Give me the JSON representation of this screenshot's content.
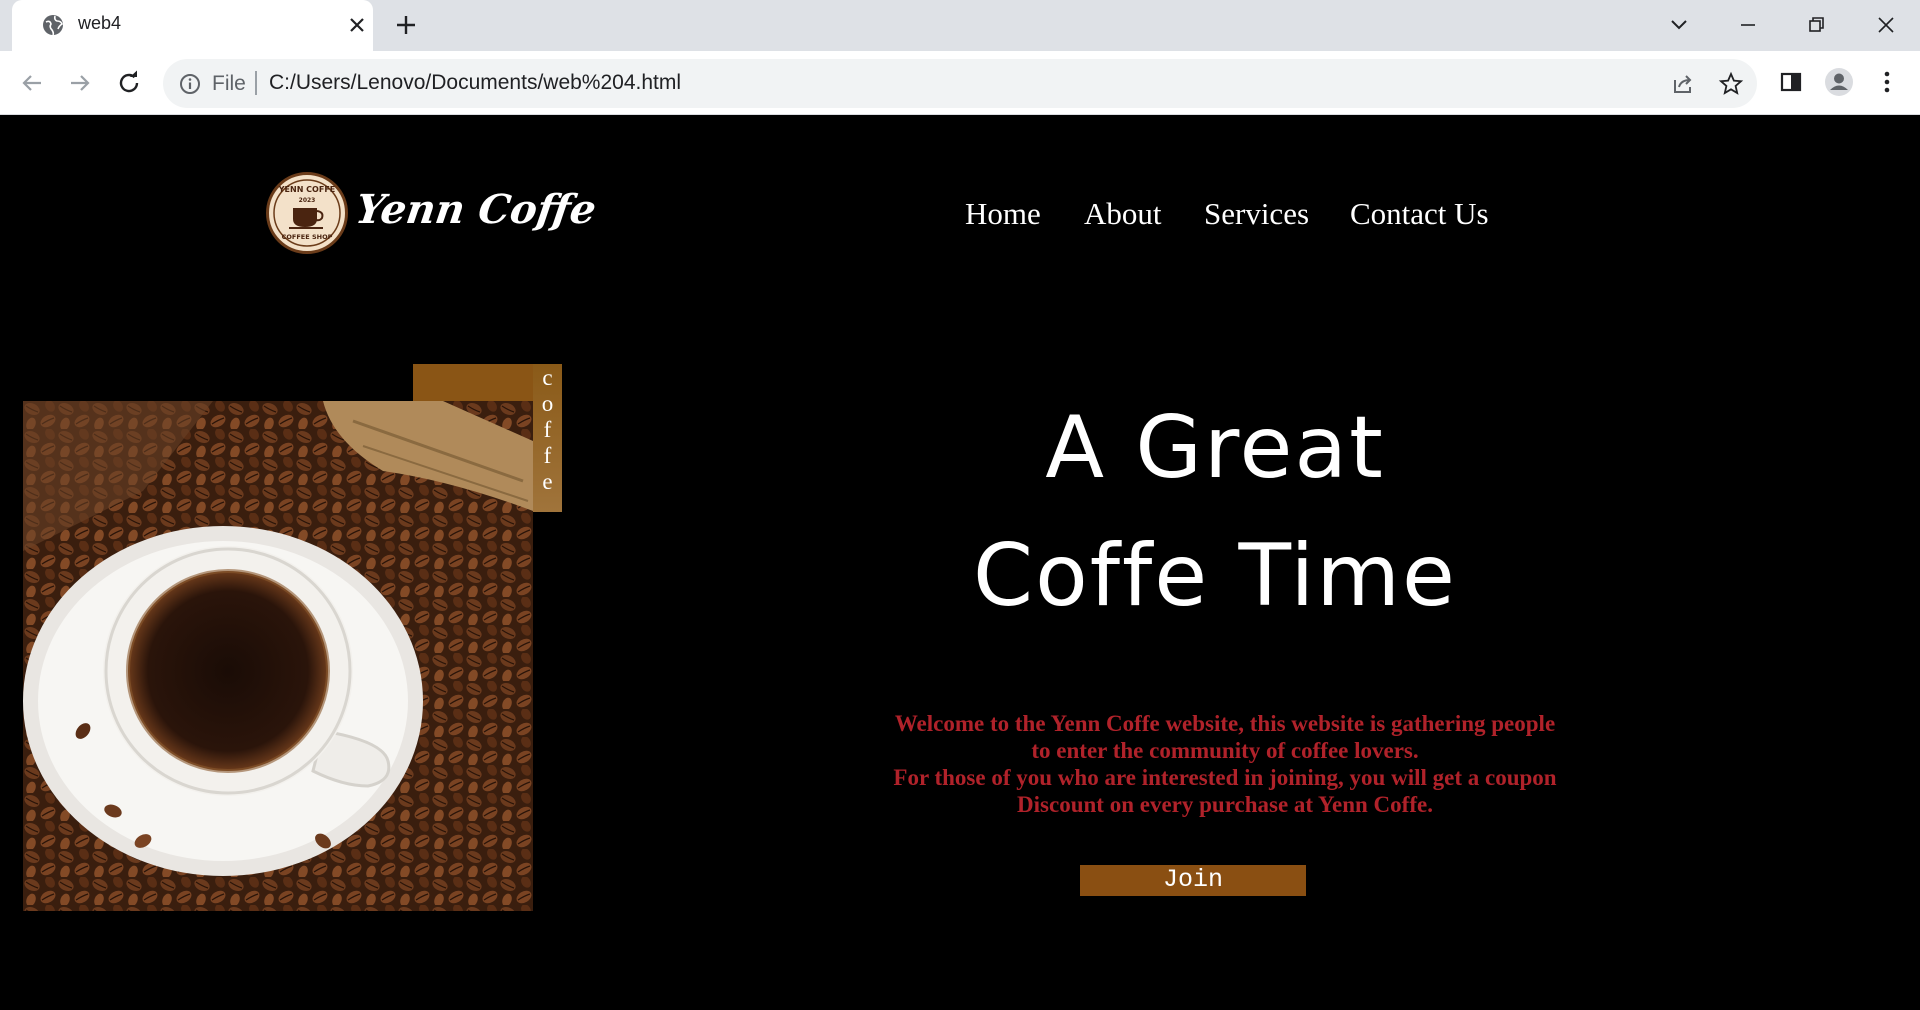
{
  "browser": {
    "tab_title": "web4",
    "address_scheme_label": "File",
    "url": "C:/Users/Lenovo/Documents/web%204.html"
  },
  "site": {
    "logo_text": "Yenn Coffe",
    "logo_badge_text": [
      "YENN COFFE",
      "2023",
      "COFFEE SHOP"
    ],
    "nav": [
      "Home",
      "About",
      "Services",
      "Contact Us"
    ],
    "side_tag_letters": [
      "c",
      "o",
      "f",
      "f",
      "e"
    ],
    "hero_title_line1": "A Great",
    "hero_title_line2": "Coffe Time",
    "description": [
      "Welcome to the Yenn Coffe website, this website is gathering people",
      "to enter the community of coffee lovers.",
      "For those of you who are interested in joining, you will get a coupon",
      "Discount on every purchase at Yenn Coffe."
    ],
    "join_label": "Join"
  },
  "colors": {
    "page_bg": "#000000",
    "accent_brown": "#8a4f12",
    "description_red": "#b0222a",
    "text_white": "#ffffff"
  }
}
